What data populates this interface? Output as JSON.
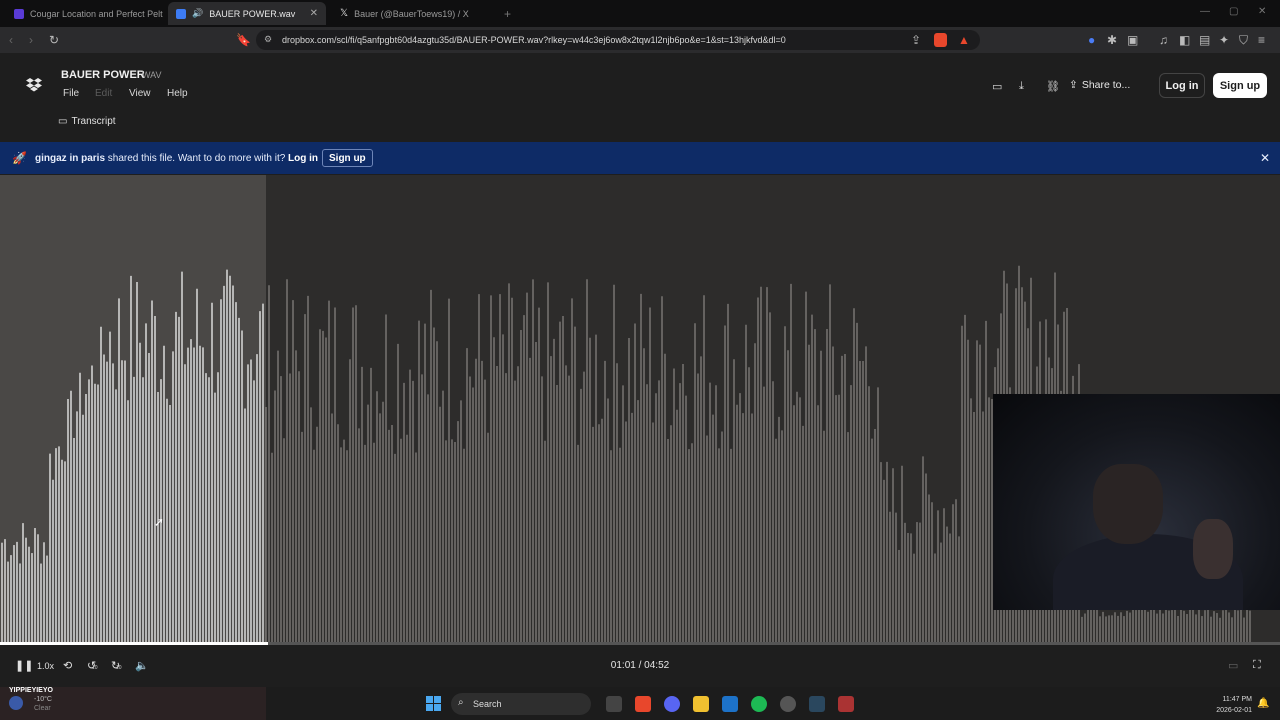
{
  "browser": {
    "tabs": [
      {
        "title": "Cougar Location and Perfect Pelt Hu",
        "active": false
      },
      {
        "title": "BAUER POWER.wav",
        "active": true
      },
      {
        "title": "Bauer (@BauerToews19) / X",
        "active": false
      }
    ],
    "url": "dropbox.com/scl/fi/q5anfpgbt60d4azgtu35d/BAUER-POWER.wav?rlkey=w44c3ej6ow8x2tqw1l2njb6po&e=1&st=13hjkfvd&dl=0",
    "brave_badge": "1"
  },
  "app": {
    "file_name": "BAUER POWER",
    "file_ext": "WAV",
    "menu": [
      "File",
      "Edit",
      "View",
      "Help"
    ],
    "transcript_label": "Transcript",
    "share_label": "Share to...",
    "login_label": "Log in",
    "signup_label": "Sign up"
  },
  "banner": {
    "sharer": "gingaz in paris",
    "message": " shared this file. Want to do more with it?",
    "login_label": "Log in",
    "signup_label": "Sign up"
  },
  "player": {
    "speed": "1.0x",
    "current_time": "01:01",
    "total_time": "04:52",
    "progress_fraction": 0.209,
    "skip_back_seconds": "10",
    "skip_forward_seconds": "10"
  },
  "taskbar": {
    "weather_title": "YIPPIEYIEYO",
    "weather_temp": "-10°C",
    "weather_cond": "Clear",
    "search_placeholder": "Search",
    "time": "11:47 PM",
    "date": "2026-02-01"
  },
  "colors": {
    "banner_bg": "#0e2b66",
    "waveform_played": "#ffffff",
    "waveform_unplayed": "#8a8784"
  }
}
